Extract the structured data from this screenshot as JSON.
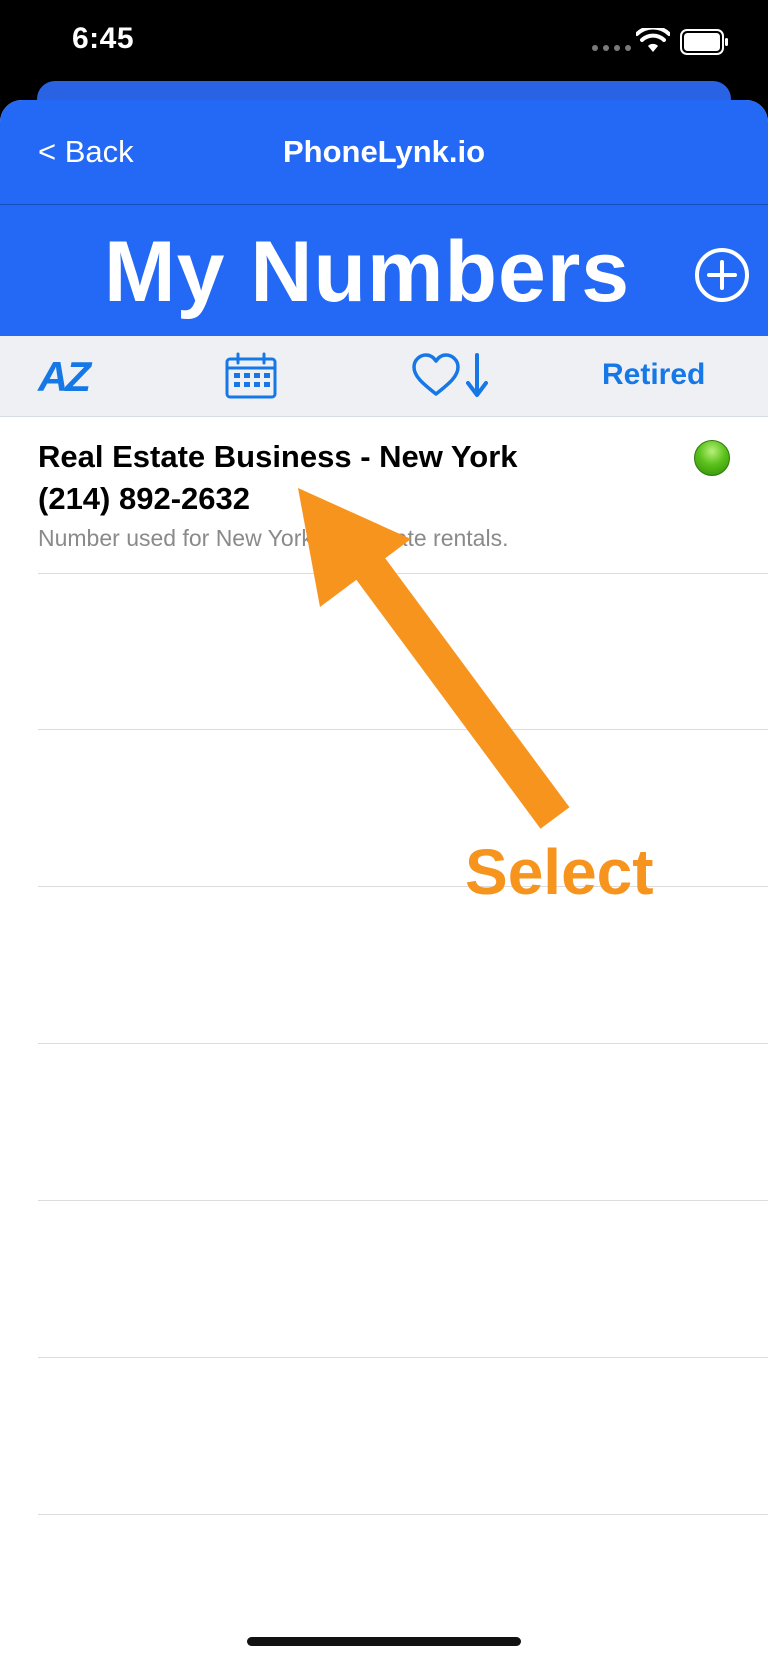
{
  "status_bar": {
    "time": "6:45"
  },
  "nav": {
    "back_label": "< Back",
    "title": "PhoneLynk.io"
  },
  "header": {
    "title": "My Numbers",
    "add_icon": "plus-circle-icon"
  },
  "filters": {
    "sort_az_label": "AZ",
    "calendar_icon": "calendar-icon",
    "favorites_icon": "heart-sort-down-icon",
    "retired_label": "Retired"
  },
  "numbers": [
    {
      "title": "Real Estate Business - New York",
      "phone": "(214) 892-2632",
      "description": "Number used for New York real estate rentals.",
      "status_color": "#4cb614"
    }
  ],
  "annotation": {
    "label": "Select",
    "color": "#f7941d"
  },
  "colors": {
    "nav_blue": "#2469f5",
    "accent_blue": "#1677e6"
  }
}
